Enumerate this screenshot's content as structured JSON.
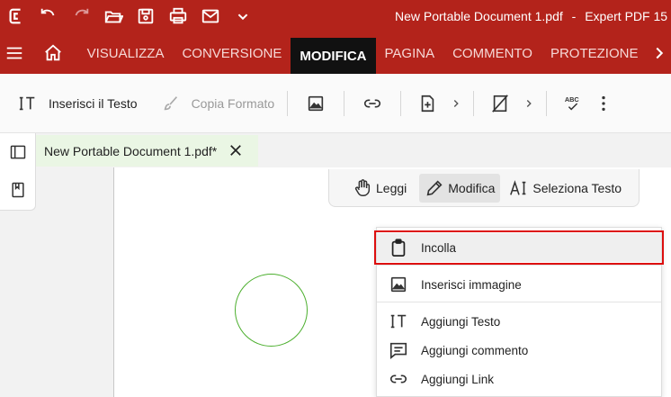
{
  "titlebar": {
    "document_title": "New Portable Document 1.pdf",
    "separator": "-",
    "app_name": "Expert PDF 15",
    "quick_access_icons": [
      "app-logo-icon",
      "undo-icon",
      "redo-icon",
      "open-folder-icon",
      "save-icon",
      "print-icon",
      "email-icon",
      "chevron-down-icon"
    ]
  },
  "ribbon": {
    "tabs": [
      {
        "label": "VISUALIZZA",
        "active": false
      },
      {
        "label": "CONVERSIONE",
        "active": false
      },
      {
        "label": "MODIFICA",
        "active": true
      },
      {
        "label": "PAGINA",
        "active": false
      },
      {
        "label": "COMMENTO",
        "active": false
      },
      {
        "label": "PROTEZIONE",
        "active": false
      }
    ]
  },
  "toolbar": {
    "insert_text": "Inserisci il Testo",
    "copy_format": "Copia Formato"
  },
  "document_tab": {
    "name": "New Portable Document 1.pdf*"
  },
  "modes": {
    "read": "Leggi",
    "edit": "Modifica",
    "select_text": "Seleziona Testo",
    "active": "Modifica"
  },
  "context_menu": {
    "items": [
      {
        "label": "Incolla",
        "icon": "clipboard-icon",
        "highlighted": true
      },
      {
        "label": "Inserisci immagine",
        "icon": "image-icon",
        "highlighted": false
      },
      {
        "label": "Aggiungi Testo",
        "icon": "text-cursor-icon",
        "highlighted": false
      },
      {
        "label": "Aggiungi commento",
        "icon": "comment-icon",
        "highlighted": false
      },
      {
        "label": "Aggiungi Link",
        "icon": "link-icon",
        "highlighted": false
      }
    ]
  },
  "colors": {
    "ribbon": "#b3231b",
    "active_tab": "#111111",
    "highlight_outline": "#dd0f0f",
    "circle_stroke": "#4caf2e"
  }
}
